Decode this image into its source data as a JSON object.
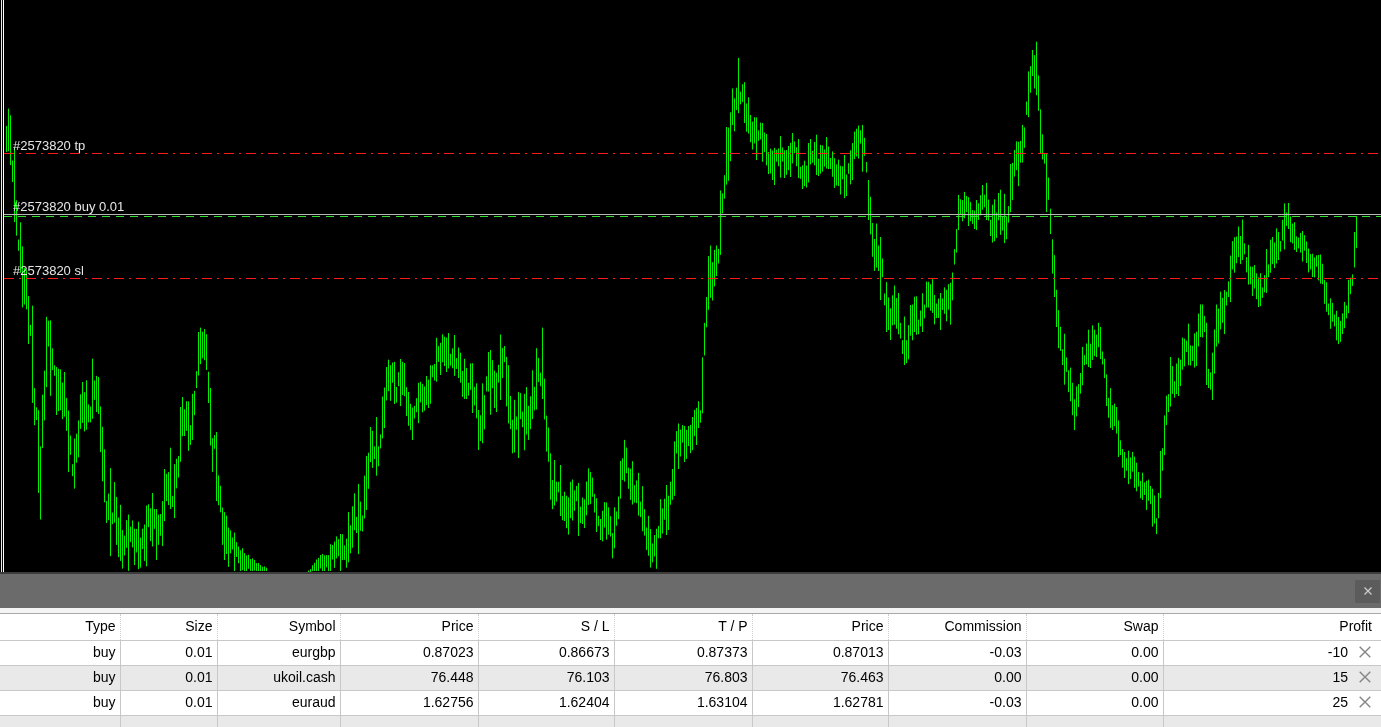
{
  "chart": {
    "trade_lines": [
      {
        "kind": "tp",
        "label": "#2573820 tp"
      },
      {
        "kind": "entry",
        "label": "#2573820 buy 0.01"
      },
      {
        "kind": "sl",
        "label": "#2573820 sl"
      }
    ]
  },
  "table": {
    "columns": [
      "Type",
      "Size",
      "Symbol",
      "Price",
      "S / L",
      "T / P",
      "Price",
      "Commission",
      "Swap",
      "Profit"
    ],
    "rows": [
      [
        "buy",
        "0.01",
        "eurgbp",
        "0.87023",
        "0.86673",
        "0.87373",
        "0.87013",
        "-0.03",
        "0.00",
        "-10"
      ],
      [
        "buy",
        "0.01",
        "ukoil.cash",
        "76.448",
        "76.103",
        "76.803",
        "76.463",
        "0.00",
        "0.00",
        "15"
      ],
      [
        "buy",
        "0.01",
        "euraud",
        "1.62756",
        "1.62404",
        "1.63104",
        "1.62781",
        "-0.03",
        "0.00",
        "25"
      ]
    ]
  }
}
